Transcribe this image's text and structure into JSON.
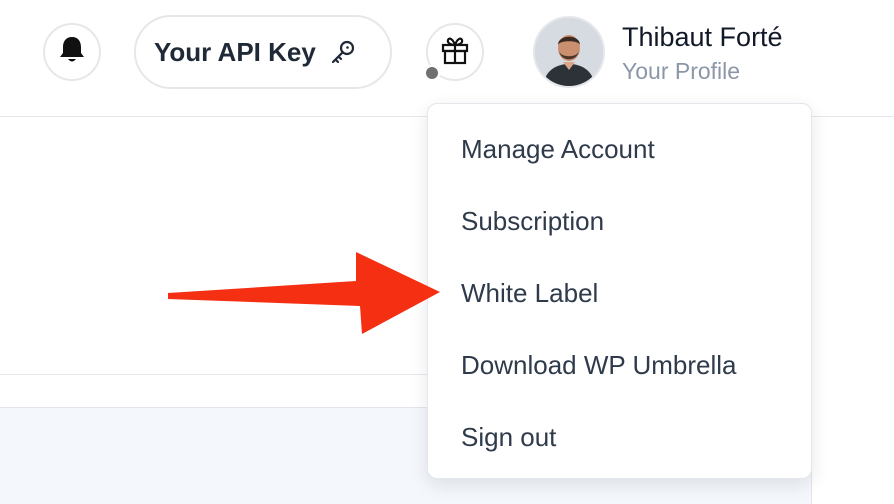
{
  "header": {
    "api_key_label": "Your API Key",
    "profile": {
      "name": "Thibaut Forté",
      "subtitle": "Your Profile"
    },
    "icons": {
      "notifications": "bell-icon",
      "api_key": "key-icon",
      "gift": "gift-icon"
    }
  },
  "profile_menu": {
    "items": [
      {
        "label": "Manage Account"
      },
      {
        "label": "Subscription"
      },
      {
        "label": "White Label"
      },
      {
        "label": "Download WP Umbrella"
      },
      {
        "label": "Sign out"
      }
    ]
  },
  "annotation": {
    "arrow_color": "#f52f12",
    "points_to": "White Label"
  },
  "colors": {
    "border": "#e5e7eb",
    "text_primary": "#1f2937",
    "text_muted": "#8b97a7",
    "menu_text": "#2f3a4a",
    "panel_bg": "#f4f7fb"
  }
}
